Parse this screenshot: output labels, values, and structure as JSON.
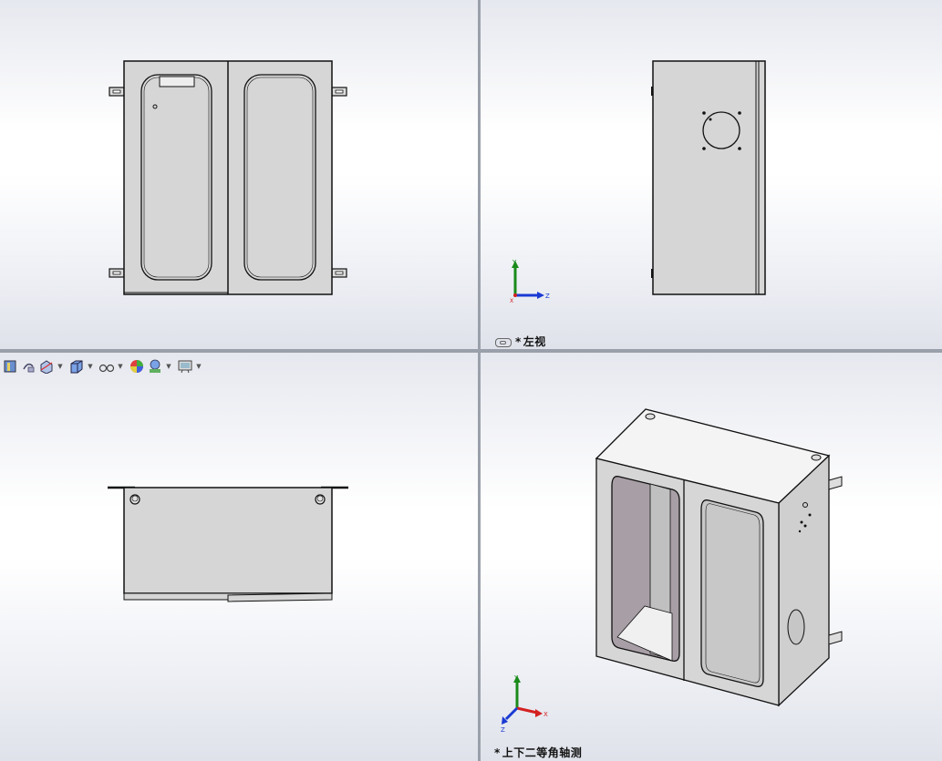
{
  "viewports": {
    "front": {
      "label": ""
    },
    "left": {
      "label_star": "*",
      "label": "左视"
    },
    "top": {
      "label": ""
    },
    "iso": {
      "label_star": "*",
      "label": "上下二等角轴测"
    }
  },
  "triad": {
    "x_label": "X",
    "y_label": "Y",
    "z_label": "Z"
  },
  "toolbar": {
    "buttons": [
      {
        "name": "zoom-to-fit-icon",
        "has_dropdown": false
      },
      {
        "name": "previous-view-icon",
        "has_dropdown": false
      },
      {
        "name": "section-view-icon",
        "has_dropdown": true
      },
      {
        "name": "view-orientation-icon",
        "has_dropdown": true
      },
      {
        "name": "display-style-icon",
        "has_dropdown": true
      },
      {
        "name": "appearance-icon",
        "has_dropdown": false
      },
      {
        "name": "scene-icon",
        "has_dropdown": true
      },
      {
        "name": "view-settings-icon",
        "has_dropdown": true
      }
    ]
  },
  "colors": {
    "part_face": "#d6d6d6",
    "inner_face": "#a89fa6",
    "edge": "#111111",
    "axis_x": "#d42020",
    "axis_y": "#1a8a1a",
    "axis_z": "#1a3ad4"
  }
}
